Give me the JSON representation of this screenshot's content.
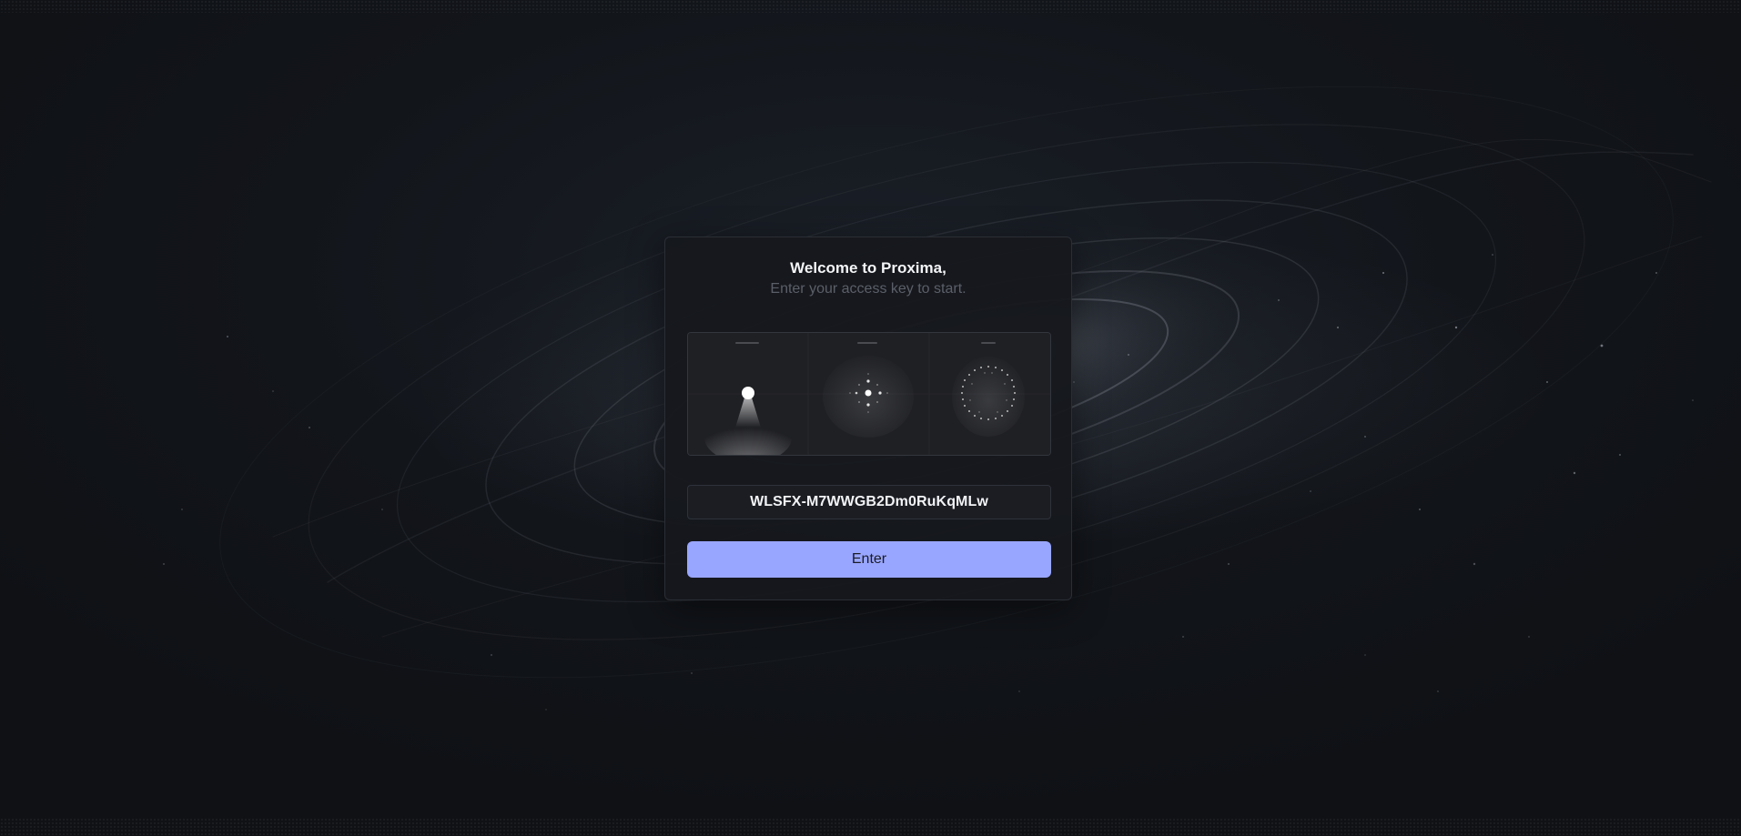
{
  "login": {
    "title": "Welcome to Proxima,",
    "subtitle": "Enter your access key to start.",
    "access_key_value": "WLSFX-M7WWGB2Dm0RuKqMLw",
    "enter_label": "Enter"
  },
  "colors": {
    "background": "#101216",
    "card": "#16181d",
    "accent_button": "#99a6ff",
    "subtitle_text": "#5b5f68"
  }
}
